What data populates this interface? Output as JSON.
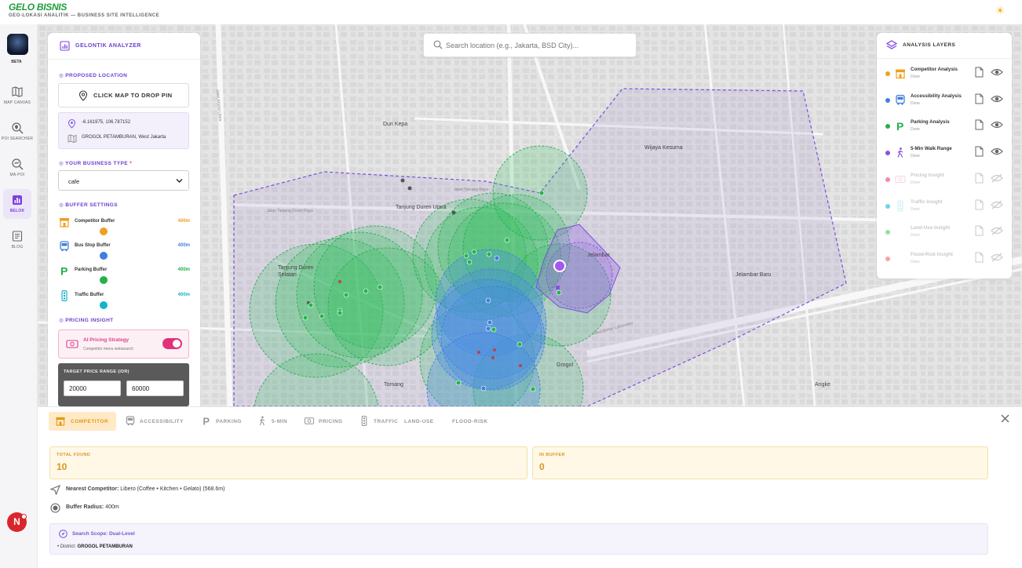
{
  "app": {
    "brand": "GELO BISNIS",
    "subtitle": "GEO-LOKASI ANALITIK — BUSINESS SITE INTELLIGENCE",
    "theme_icon": "sun-icon"
  },
  "nav": {
    "beta_label": "BETA",
    "items": [
      {
        "label": "MAP CANVAS",
        "icon": "map-icon"
      },
      {
        "label": "POI SEARCHER",
        "icon": "poi-search-icon"
      },
      {
        "label": "MA-POI",
        "icon": "ma-poi-icon"
      },
      {
        "label": "BELOK",
        "icon": "chart-icon",
        "active": true
      },
      {
        "label": "BLOG",
        "icon": "blog-icon"
      }
    ],
    "avatar_initial": "N"
  },
  "search": {
    "placeholder": "Search location (e.g., Jakarta, BSD City)..."
  },
  "analyzer": {
    "title": "GELONTIK ANALYZER",
    "proposed_location_title": "PROPOSED LOCATION",
    "drop_pin_label": "CLICK MAP TO DROP PIN",
    "coordinates": "-6.161975, 106.787152",
    "address": "GROGOL PETAMBURAN, West Jakarta",
    "business_type_title": "YOUR BUSINESS TYPE",
    "business_type_required": "*",
    "business_type_value": "cafe",
    "buffer_settings_title": "BUFFER SETTINGS",
    "buffers": [
      {
        "label": "Competitor Buffer",
        "value": "400m",
        "color": "#f0a020"
      },
      {
        "label": "Bus Stop Buffer",
        "value": "400m",
        "color": "#3f7fe0"
      },
      {
        "label": "Parking Buffer",
        "value": "400m",
        "color": "#25b04a"
      },
      {
        "label": "Traffic Buffer",
        "value": "400m",
        "color": "#16b3c8"
      }
    ],
    "pricing_insight_title": "PRICING INSIGHT",
    "ai_pricing_title": "AI Pricing Strategy",
    "ai_pricing_sub": "Competitor menu websearch",
    "ai_pricing_enabled": true,
    "price_range_title": "TARGET PRICE RANGE (IDR)",
    "price_min": "20000",
    "price_max": "60000"
  },
  "map": {
    "labels": [
      "Duri Kepa",
      "Wijaya Kesuma",
      "Tanjung Duren Utara",
      "Tanjung Duren Selatan",
      "Jelambar",
      "Jelambar Baru",
      "Grogol",
      "Tomang",
      "Angke"
    ],
    "street_labels": [
      "Jalan Tanjung Duren Raya",
      "Jalan Arjuna Utara",
      "Jalan Dokter Latumeten",
      "Jalan Tomang Raya"
    ]
  },
  "layers": {
    "title": "ANALYSIS LAYERS",
    "items": [
      {
        "name": "Competitor Analysis",
        "status": "Done",
        "color": "#f0a020",
        "icon": "store-icon",
        "visible": true
      },
      {
        "name": "Accessibility Analysis",
        "status": "Done",
        "color": "#3f7fe0",
        "icon": "bus-icon",
        "visible": true
      },
      {
        "name": "Parking Analysis",
        "status": "Done",
        "color": "#25b04a",
        "icon": "parking-icon",
        "visible": true
      },
      {
        "name": "5-Min Walk Range",
        "status": "Done",
        "color": "#8a4fe0",
        "icon": "walk-icon",
        "visible": true
      },
      {
        "name": "Pricing Insight",
        "status": "Done",
        "color": "#f28ab0",
        "icon": "money-icon",
        "visible": false
      },
      {
        "name": "Traffic Insight",
        "status": "Done",
        "color": "#6fd6e2",
        "icon": "traffic-light-icon",
        "visible": false
      },
      {
        "name": "Land-Use Insight",
        "status": "Done",
        "color": "#8fe2a0",
        "icon": "",
        "visible": false
      },
      {
        "name": "Flood-Risk Insight",
        "status": "Done",
        "color": "#f4a3a8",
        "icon": "",
        "visible": false
      }
    ]
  },
  "results": {
    "tabs": [
      {
        "label": "COMPETITOR",
        "icon": "store-icon",
        "active": true
      },
      {
        "label": "ACCESSIBILITY",
        "icon": "bus-icon"
      },
      {
        "label": "PARKING",
        "icon": "parking-icon"
      },
      {
        "label": "5-MIN",
        "icon": "walk-icon"
      },
      {
        "label": "PRICING",
        "icon": "money-icon"
      },
      {
        "label": "TRAFFIC",
        "icon": "traffic-light-icon"
      },
      {
        "label": "LAND-USE",
        "icon": ""
      },
      {
        "label": "FLOOD-RISK",
        "icon": ""
      }
    ],
    "total_found_label": "TOTAL FOUND",
    "total_found_value": "10",
    "in_buffer_label": "IN BUFFER",
    "in_buffer_value": "0",
    "nearest_label": "Nearest Competitor:",
    "nearest_value": "Libero (Coffee • Kitchen • Gelato) (568.6m)",
    "radius_label": "Buffer Radius:",
    "radius_value": "400m",
    "scope_title": "Search Scope: Dual-Level",
    "district_label": "• District:",
    "district_value": "GROGOL PETAMBURAN"
  }
}
